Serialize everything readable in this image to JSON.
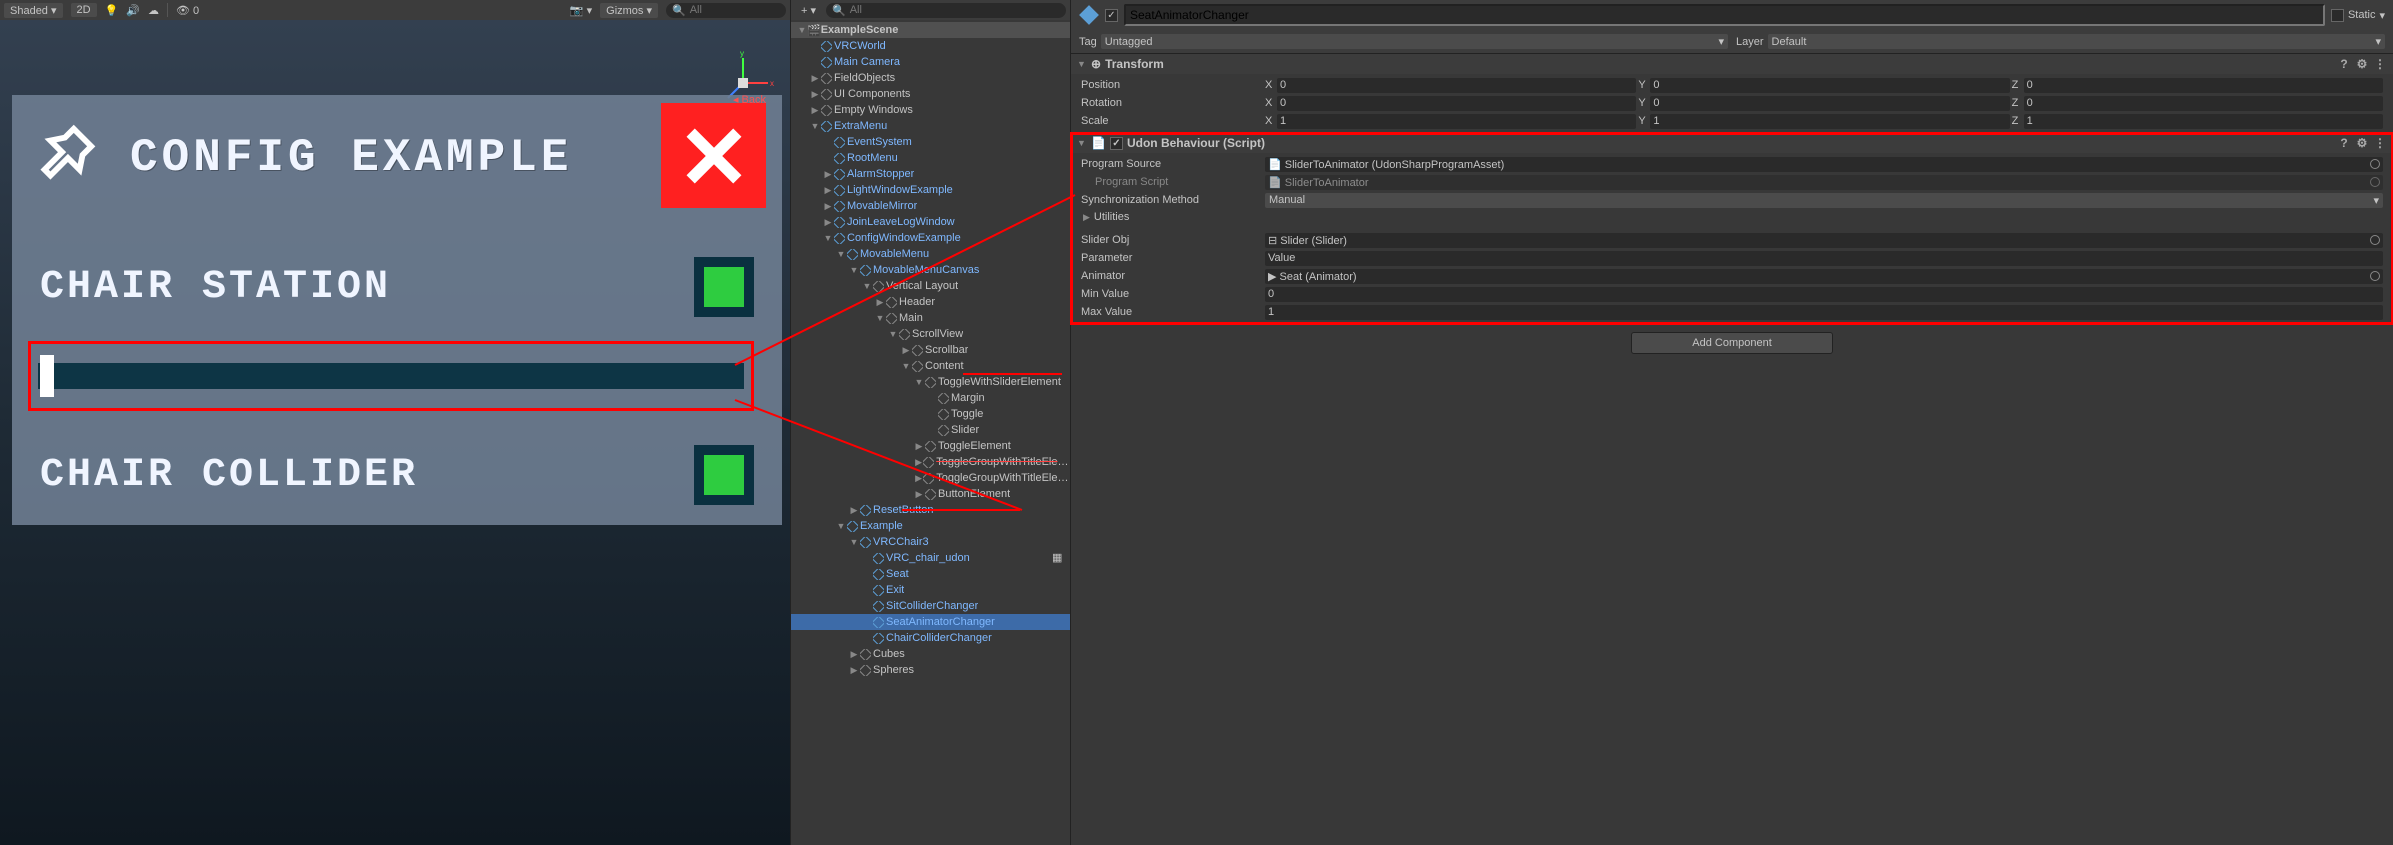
{
  "scene_toolbar": {
    "shading": "Shaded",
    "mode": "2D",
    "gizmos": "Gizmos",
    "search_placeholder": "All"
  },
  "config_panel": {
    "title": "CONFIG EXAMPLE",
    "back": "Back",
    "rows": [
      {
        "label": "CHAIR STATION"
      },
      {
        "label": "CHAIR COLLIDER"
      }
    ]
  },
  "hierarchy": {
    "search_placeholder": "All",
    "scene": "ExampleScene",
    "items": [
      "VRCWorld",
      "Main Camera",
      "FieldObjects",
      "UI Components",
      "Empty Windows",
      "ExtraMenu",
      "EventSystem",
      "RootMenu",
      "AlarmStopper",
      "LightWindowExample",
      "MovableMirror",
      "JoinLeaveLogWindow",
      "ConfigWindowExample",
      "MovableMenu",
      "MovableMenuCanvas",
      "Vertical Layout",
      "Header",
      "Main",
      "ScrollView",
      "Scrollbar",
      "Content",
      "ToggleWithSliderElement",
      "Margin",
      "Toggle",
      "Slider",
      "ToggleElement",
      "ToggleGroupWithTitleElement",
      "ToggleGroupWithTitleElement",
      "ButtonElement",
      "ResetButton",
      "Example",
      "VRCChair3",
      "VRC_chair_udon",
      "Seat",
      "Exit",
      "SitColliderChanger",
      "SeatAnimatorChanger",
      "ChairColliderChanger",
      "Cubes",
      "Spheres"
    ]
  },
  "inspector": {
    "name": "SeatAnimatorChanger",
    "static_label": "Static",
    "tag_label": "Tag",
    "tag_value": "Untagged",
    "layer_label": "Layer",
    "layer_value": "Default",
    "transform": {
      "title": "Transform",
      "position_label": "Position",
      "rotation_label": "Rotation",
      "scale_label": "Scale",
      "position": {
        "x": "0",
        "y": "0",
        "z": "0"
      },
      "rotation": {
        "x": "0",
        "y": "0",
        "z": "0"
      },
      "scale": {
        "x": "1",
        "y": "1",
        "z": "1"
      }
    },
    "udon": {
      "title": "Udon Behaviour (Script)",
      "program_source_label": "Program Source",
      "program_source_value": "SliderToAnimator (UdonSharpProgramAsset)",
      "program_script_label": "Program Script",
      "program_script_value": "SliderToAnimator",
      "sync_label": "Synchronization Method",
      "sync_value": "Manual",
      "utilities_label": "Utilities",
      "slider_obj_label": "Slider Obj",
      "slider_obj_value": "Slider (Slider)",
      "parameter_label": "Parameter",
      "parameter_value": "Value",
      "animator_label": "Animator",
      "animator_value": "Seat (Animator)",
      "min_label": "Min Value",
      "min_value": "0",
      "max_label": "Max Value",
      "max_value": "1"
    },
    "add_component": "Add Component"
  }
}
